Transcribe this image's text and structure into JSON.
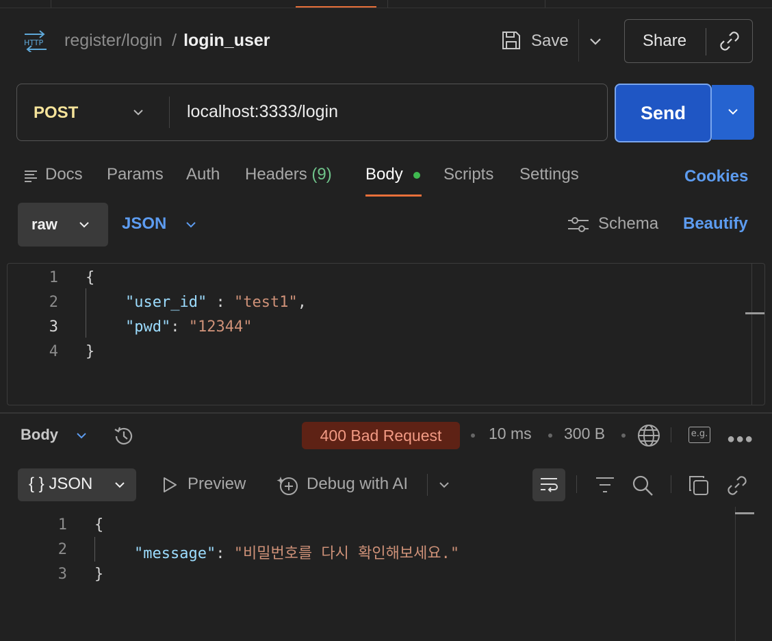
{
  "header": {
    "protocol_icon": "http-icon",
    "collection": "register/login",
    "separator": "/",
    "request_name": "login_user",
    "save_label": "Save",
    "share_label": "Share"
  },
  "request": {
    "method": "POST",
    "url": "localhost:3333/login",
    "send_label": "Send"
  },
  "tabs": {
    "docs": "Docs",
    "params": "Params",
    "auth": "Auth",
    "headers": "Headers",
    "headers_count": "(9)",
    "body": "Body",
    "scripts": "Scripts",
    "settings": "Settings",
    "cookies": "Cookies",
    "active": "Body"
  },
  "body_options": {
    "mode": "raw",
    "language": "JSON",
    "schema_label": "Schema",
    "beautify_label": "Beautify"
  },
  "request_body": {
    "line_numbers": [
      "1",
      "2",
      "3",
      "4"
    ],
    "open_brace": "{",
    "close_brace": "}",
    "user_id_key": "\"user_id\"",
    "user_id_sep": " : ",
    "user_id_value": "\"test1\"",
    "pwd_key": "\"pwd\"",
    "pwd_sep": ": ",
    "pwd_value": "\"12344\"",
    "comma": ","
  },
  "response": {
    "body_label": "Body",
    "status": "400 Bad Request",
    "time": "10 ms",
    "size": "300 B",
    "eg_label": "e.g.",
    "format_label": "JSON",
    "format_glyph": "{ }",
    "preview_label": "Preview",
    "debug_label": "Debug with AI",
    "line_numbers": [
      "1",
      "2",
      "3"
    ],
    "open_brace": "{",
    "close_brace": "}",
    "message_key": "\"message\"",
    "message_sep": ": ",
    "message_value": "\"비밀번호를 다시 확인해보세요.\""
  },
  "colors": {
    "accent_orange": "#e8703a",
    "link_blue": "#5d9cf0",
    "send_blue": "#1f56c4",
    "method_yellow": "#f5e39a",
    "status_bg": "#5e2215",
    "status_text": "#f29a84",
    "json_key": "#9cdcfe",
    "json_string": "#ce9178"
  }
}
